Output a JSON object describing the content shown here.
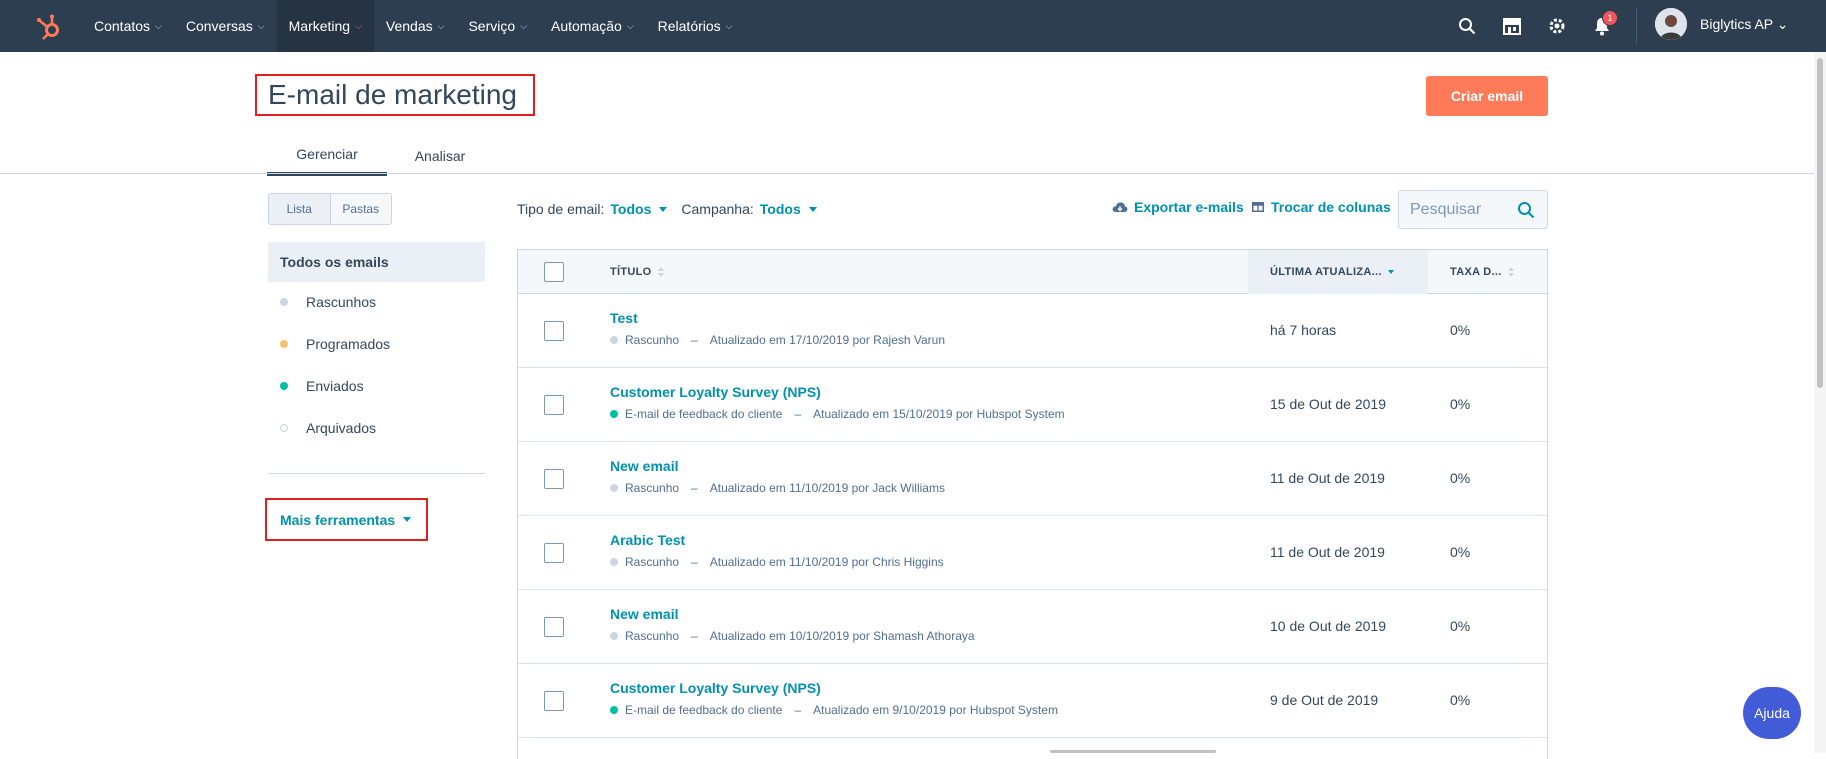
{
  "nav": {
    "items": [
      {
        "label": "Contatos"
      },
      {
        "label": "Conversas"
      },
      {
        "label": "Marketing"
      },
      {
        "label": "Vendas"
      },
      {
        "label": "Serviço"
      },
      {
        "label": "Automação"
      },
      {
        "label": "Relatórios"
      }
    ],
    "active": "Marketing",
    "notification_count": "1",
    "account": "Biglytics AP ⌄"
  },
  "header": {
    "title": "E-mail de marketing",
    "create_button": "Criar email",
    "tabs": [
      {
        "label": "Gerenciar"
      },
      {
        "label": "Analisar"
      }
    ]
  },
  "sidebar": {
    "view_toggle": [
      "Lista",
      "Pastas"
    ],
    "all_emails": "Todos os emails",
    "items": [
      {
        "label": "Rascunhos",
        "color": "#cbd6e2"
      },
      {
        "label": "Programados",
        "color": "#f5c26b"
      },
      {
        "label": "Enviados",
        "color": "#00bda5"
      },
      {
        "label": "Arquivados",
        "color": "#ffffff"
      }
    ],
    "more_tools": "Mais ferramentas"
  },
  "filters": {
    "type_label": "Tipo de email:",
    "type_value": "Todos",
    "campaign_label": "Campanha:",
    "campaign_value": "Todos",
    "export": "Exportar e-mails",
    "swap_columns": "Trocar de colunas",
    "search_placeholder": "Pesquisar"
  },
  "table": {
    "columns": [
      "TÍTULO",
      "ÚLTIMA ATUALIZA...",
      "TAXA D..."
    ],
    "rows": [
      {
        "title": "Test",
        "status": "Rascunho",
        "status_color": "#cbd6e2",
        "detail": "Atualizado em 17/10/2019 por Rajesh Varun",
        "updated": "há 7 horas",
        "rate": "0%"
      },
      {
        "title": "Customer Loyalty Survey (NPS)",
        "status": "E-mail de feedback do cliente",
        "status_color": "#00bda5",
        "detail": "Atualizado em 15/10/2019 por Hubspot System",
        "updated": "15 de Out de 2019",
        "rate": "0%"
      },
      {
        "title": "New email",
        "status": "Rascunho",
        "status_color": "#cbd6e2",
        "detail": "Atualizado em 11/10/2019 por Jack Williams",
        "updated": "11 de Out de 2019",
        "rate": "0%"
      },
      {
        "title": "Arabic Test",
        "status": "Rascunho",
        "status_color": "#cbd6e2",
        "detail": "Atualizado em 11/10/2019 por Chris Higgins",
        "updated": "11 de Out de 2019",
        "rate": "0%"
      },
      {
        "title": "New email",
        "status": "Rascunho",
        "status_color": "#cbd6e2",
        "detail": "Atualizado em 10/10/2019 por Shamash Athoraya",
        "updated": "10 de Out de 2019",
        "rate": "0%"
      },
      {
        "title": "Customer Loyalty Survey (NPS)",
        "status": "E-mail de feedback do cliente",
        "status_color": "#00bda5",
        "detail": "Atualizado em 9/10/2019 por Hubspot System",
        "updated": "9 de Out de 2019",
        "rate": "0%"
      }
    ]
  },
  "help": "Ajuda",
  "colors": {
    "accent": "#ff7a59",
    "link": "#0091ae",
    "nav_bg": "#2d3e50",
    "highlight_box": "#e02020"
  }
}
